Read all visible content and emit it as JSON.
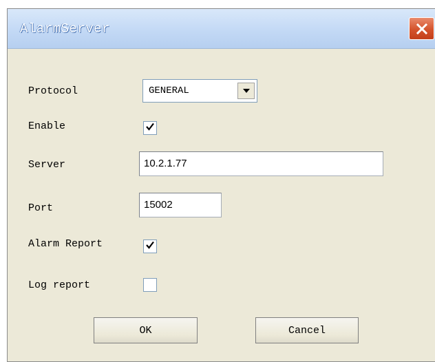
{
  "window": {
    "title": "AlarmServer",
    "close_icon": "close-x-icon"
  },
  "form": {
    "protocol": {
      "label": "Protocol",
      "value": "GENERAL",
      "dropdown_icon": "triangle-down-icon"
    },
    "enable": {
      "label": "Enable",
      "checked": true
    },
    "server": {
      "label": "Server",
      "value": "10.2.1.77"
    },
    "port": {
      "label": "Port",
      "value": "15002"
    },
    "alarm_report": {
      "label": "Alarm Report",
      "checked": true
    },
    "log_report": {
      "label": "Log report",
      "checked": false
    }
  },
  "buttons": {
    "ok_label": "OK",
    "cancel_label": "Cancel"
  },
  "colors": {
    "dialog_background": "#ece9d8",
    "titlebar": "#c3d9f5",
    "close_button": "#d4532c"
  }
}
